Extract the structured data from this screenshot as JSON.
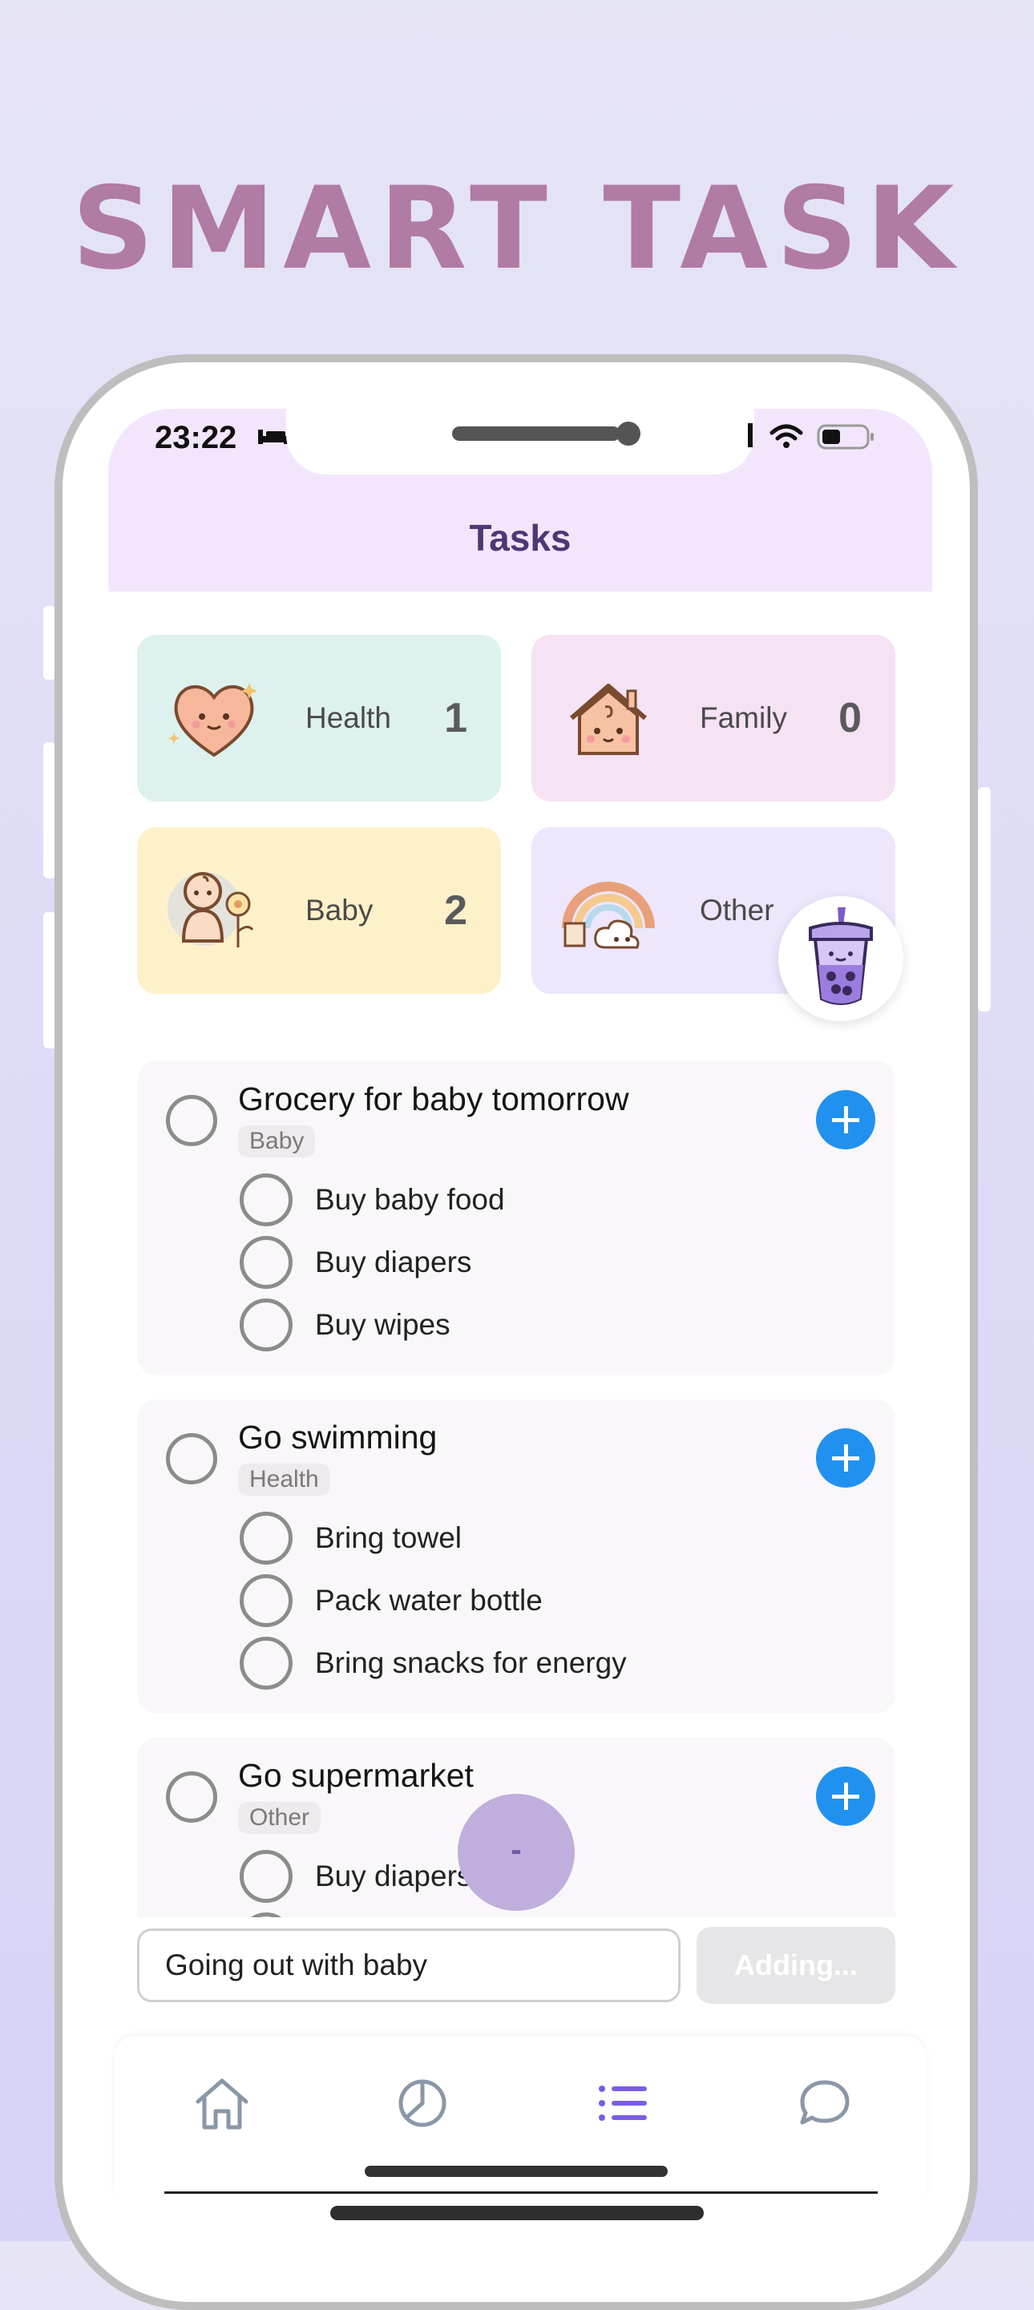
{
  "promo": {
    "title": "SMART TASK"
  },
  "status_bar": {
    "time": "23:22"
  },
  "header": {
    "title": "Tasks"
  },
  "categories": [
    {
      "name": "Health",
      "count": "1",
      "icon": "heart-icon",
      "color": "#DDF1EF"
    },
    {
      "name": "Family",
      "count": "0",
      "icon": "house-icon",
      "color": "#F5E2F3"
    },
    {
      "name": "Baby",
      "count": "2",
      "icon": "baby-icon",
      "color": "#FEF1C9"
    },
    {
      "name": "Other",
      "count": "",
      "icon": "rainbow-icon",
      "color": "#EDE6FC"
    }
  ],
  "tasks": [
    {
      "title": "Grocery for baby tomorrow",
      "category": "Baby",
      "subtasks": [
        "Buy baby food",
        "Buy diapers",
        "Buy wipes"
      ]
    },
    {
      "title": "Go swimming",
      "category": "Health",
      "subtasks": [
        "Bring towel",
        "Pack water bottle",
        "Bring snacks for energy"
      ]
    },
    {
      "title": "Go supermarket",
      "category": "Other",
      "subtasks": [
        "Buy diapers"
      ]
    }
  ],
  "fab": {
    "minus_label": "-"
  },
  "input": {
    "value": "Going out with baby"
  },
  "add_button": {
    "label": "Adding..."
  },
  "tabbar": {
    "items": [
      "home-icon",
      "chart-icon",
      "list-icon",
      "chat-icon"
    ],
    "active_color": "#7B5CE6",
    "inactive_color": "#8A97A8"
  },
  "colors": {
    "accent_blue": "#2191F0",
    "title": "#B07BA5",
    "header_bg": "#F3E6FC"
  }
}
